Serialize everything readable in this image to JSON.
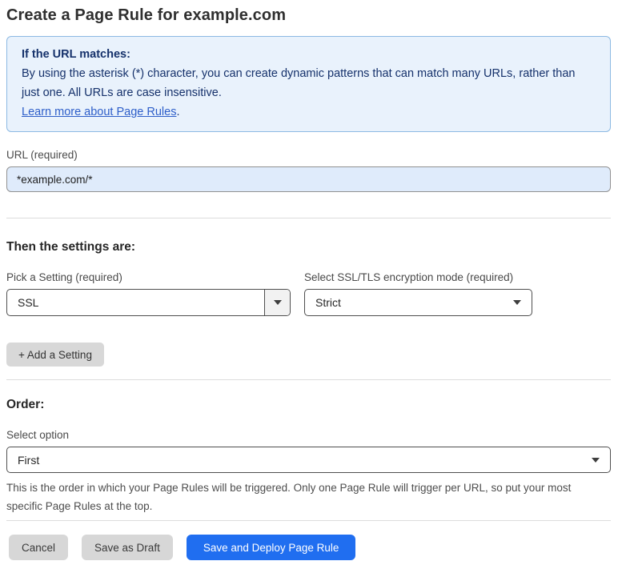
{
  "page": {
    "title": "Create a Page Rule for example.com"
  },
  "info_box": {
    "heading": "If the URL matches:",
    "body": "By using the asterisk (*) character, you can create dynamic patterns that can match many URLs, rather than just one. All URLs are case insensitive.",
    "link": "Learn more about Page Rules",
    "link_suffix": "."
  },
  "url_field": {
    "label": "URL (required)",
    "value": "*example.com/*"
  },
  "settings": {
    "heading": "Then the settings are:",
    "pick_setting": {
      "label": "Pick a Setting (required)",
      "value": "SSL"
    },
    "encryption_mode": {
      "label": "Select SSL/TLS encryption mode (required)",
      "value": "Strict"
    },
    "add_button_label": "+ Add a Setting"
  },
  "order": {
    "heading": "Order:",
    "label": "Select option",
    "value": "First",
    "help": "This is the order in which your Page Rules will be triggered. Only one Page Rule will trigger per URL, so put your most specific Page Rules at the top."
  },
  "footer": {
    "cancel_label": "Cancel",
    "save_draft_label": "Save as Draft",
    "save_deploy_label": "Save and Deploy Page Rule"
  },
  "colors": {
    "accent-blue": "#206ef0",
    "info-bg": "#e9f2fc",
    "info-border": "#8cb9e3",
    "info-text": "#15316b",
    "link-blue": "#2d5ec9",
    "input-bg": "#dfebfb"
  }
}
